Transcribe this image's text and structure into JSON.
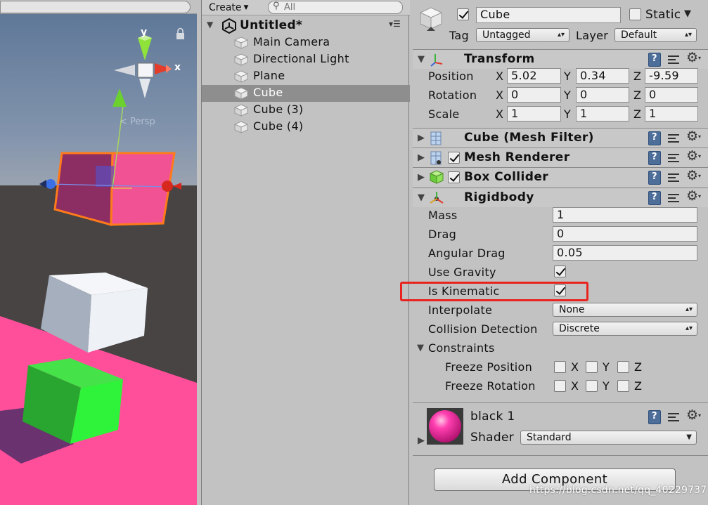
{
  "scene_view": {
    "gizmo_y_label": "y",
    "gizmo_x_label": "x",
    "projection_label": "< Persp",
    "colors": {
      "sky": "#6f86a5",
      "ground": "#474443",
      "pink": "#ff4f9a",
      "green": "#2ff23a",
      "white_cube": "#e9eef4"
    }
  },
  "hierarchy": {
    "create_label": "Create",
    "search_placeholder": "All",
    "scene_name": "Untitled*",
    "items": [
      {
        "label": "Main Camera",
        "selected": false
      },
      {
        "label": "Directional Light",
        "selected": false
      },
      {
        "label": "Plane",
        "selected": false
      },
      {
        "label": "Cube",
        "selected": true
      },
      {
        "label": "Cube (3)",
        "selected": false
      },
      {
        "label": "Cube (4)",
        "selected": false
      }
    ]
  },
  "inspector": {
    "object_name": "Cube",
    "static_label": "Static",
    "tag_label": "Tag",
    "tag_value": "Untagged",
    "layer_label": "Layer",
    "layer_value": "Default",
    "transform": {
      "title": "Transform",
      "rows": [
        {
          "label": "Position",
          "x": "5.02",
          "y": "0.34",
          "z": "-9.59"
        },
        {
          "label": "Rotation",
          "x": "0",
          "y": "0",
          "z": "0"
        },
        {
          "label": "Scale",
          "x": "1",
          "y": "1",
          "z": "1"
        }
      ],
      "axis_x": "X",
      "axis_y": "Y",
      "axis_z": "Z"
    },
    "mesh_filter_title": "Cube (Mesh Filter)",
    "mesh_renderer_title": "Mesh Renderer",
    "box_collider_title": "Box Collider",
    "rigidbody": {
      "title": "Rigidbody",
      "mass_label": "Mass",
      "mass": "1",
      "drag_label": "Drag",
      "drag": "0",
      "angular_drag_label": "Angular Drag",
      "angular_drag": "0.05",
      "use_gravity_label": "Use Gravity",
      "use_gravity": true,
      "is_kinematic_label": "Is Kinematic",
      "is_kinematic": true,
      "interpolate_label": "Interpolate",
      "interpolate": "None",
      "collision_label": "Collision Detection",
      "collision": "Discrete",
      "constraints_label": "Constraints",
      "freeze_position_label": "Freeze Position",
      "freeze_rotation_label": "Freeze Rotation"
    },
    "material": {
      "name": "black 1",
      "shader_label": "Shader",
      "shader": "Standard",
      "ball_color": "#ff3fb0"
    },
    "add_component_label": "Add Component",
    "highlight_color": "#e8231f"
  },
  "watermark": "https://blog.csdn.net/qq_40229737"
}
